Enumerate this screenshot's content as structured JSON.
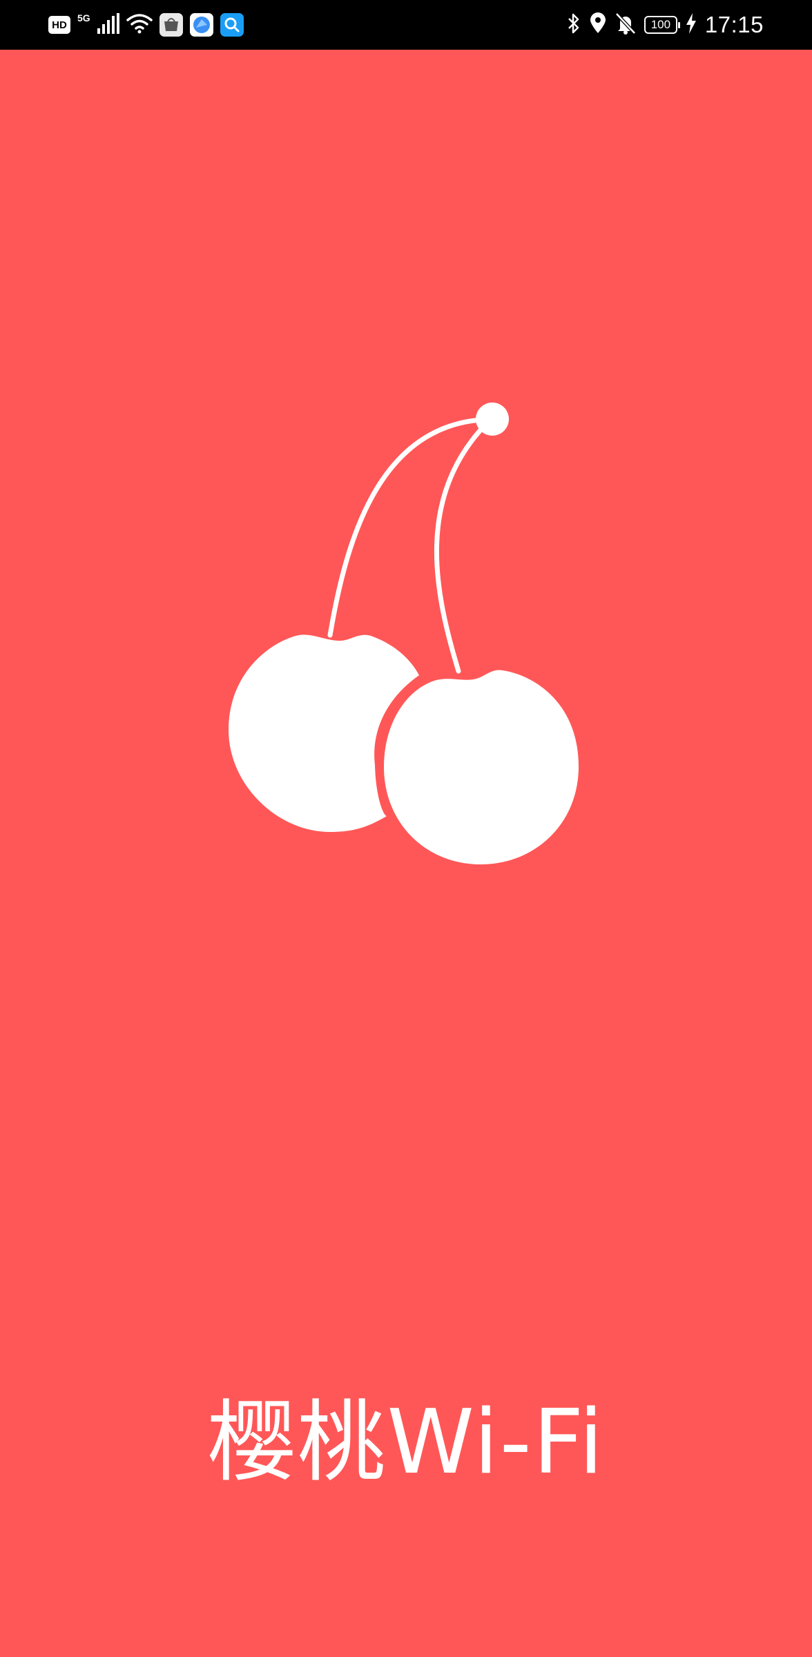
{
  "status_bar": {
    "hd_label": "HD",
    "network_label": "5G",
    "battery_level": "100",
    "time": "17:15",
    "left_icons": [
      "hd-icon",
      "signal-icon",
      "wifi-icon",
      "huawei-market-icon",
      "browser-icon",
      "search-app-icon"
    ],
    "right_icons": [
      "bluetooth-icon",
      "location-icon",
      "mute-bell-icon",
      "battery-icon",
      "charging-icon"
    ]
  },
  "splash": {
    "logo_icon": "cherry-icon",
    "title": "樱桃Wi-Fi"
  },
  "colors": {
    "background": "#FF5757",
    "foreground": "#FFFFFF",
    "status_bar": "#000000"
  }
}
